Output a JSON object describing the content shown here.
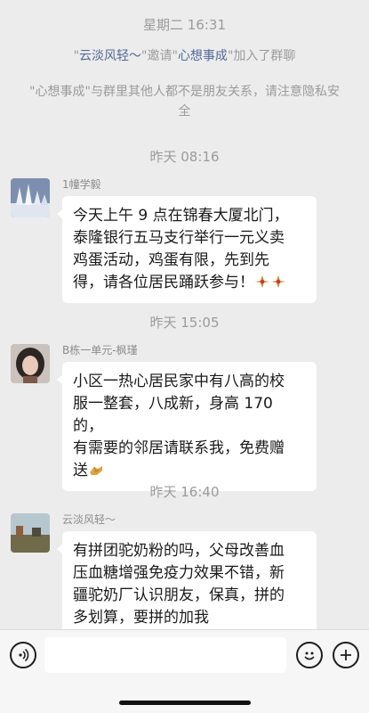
{
  "chat": {
    "times": [
      "星期二 16:31",
      "昨天 08:16",
      "昨天 15:05",
      "昨天 16:40"
    ],
    "join_notice": {
      "q1": "\"",
      "inviter": "云淡风轻～",
      "mid1": "\"邀请\"",
      "invitee": "心想事成",
      "tail": "\"加入了群聊"
    },
    "privacy_notice": {
      "q1": "\"",
      "name": "心想事成",
      "tail": "\"与群里其他人都不是朋友关系，请注意隐私安全"
    },
    "messages": [
      {
        "sender": "1幢学毅",
        "text": "今天上午 9 点在锦春大厦北门，\n泰隆银行五马支行举行一元义卖\n鸡蛋活动，鸡蛋有限，先到先\n得，请各位居民踊跃参与！",
        "emoji": "firecracker-icon"
      },
      {
        "sender": "B栋一单元-枫瑾",
        "text": "小区一热心居民家中有八高的校\n服一整套，八成新，身高 170 的，\n有需要的邻居请联系我，免费赠\n送",
        "emoji": "handshake-icon"
      },
      {
        "sender": "云淡风轻～",
        "text": "有拼团驼奶粉的吗，父母改善血\n压血糖增强免疫力效果不错，新\n疆驼奶厂认识朋友，保真，拼的\n多划算，要拼的加我"
      }
    ]
  },
  "input_bar": {
    "placeholder": "",
    "icons": [
      "voice-icon",
      "emoji-icon",
      "plus-icon"
    ]
  },
  "colors": {
    "background": "#ececec",
    "bubble": "#ffffff",
    "time_text": "#9b9b9b",
    "name_highlight": "#556b9a"
  }
}
